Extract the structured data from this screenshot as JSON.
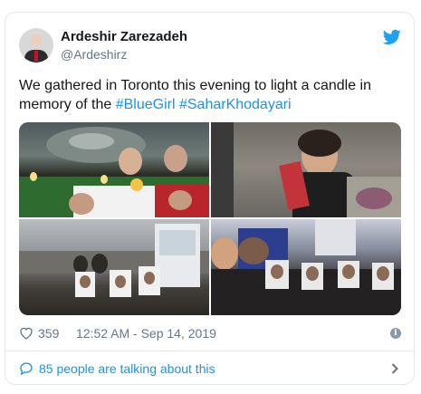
{
  "author": {
    "name": "Ardeshir Zarezadeh",
    "handle": "@Ardeshirz"
  },
  "tweet": {
    "text": "We gathered in Toronto this evening to light a candle in memory of the ",
    "hashtags": [
      "#BlueGirl",
      "#SaharKhodayari"
    ]
  },
  "media": {
    "photos": [
      {
        "name": "candle-vigil-fountain"
      },
      {
        "name": "woman-holding-sign"
      },
      {
        "name": "vigil-line-portraits"
      },
      {
        "name": "group-with-portraits-street"
      }
    ]
  },
  "meta": {
    "likes": "359",
    "timestamp": "12:52 AM - Sep 14, 2019",
    "info_label": "i"
  },
  "footer": {
    "talking": "85 people are talking about this"
  },
  "colors": {
    "link": "#1b95e0",
    "secondary": "#657786",
    "border": "#e1e8ed"
  },
  "icons": [
    "twitter-bird-icon",
    "heart-icon",
    "info-icon",
    "speech-bubble-icon",
    "chevron-right-icon"
  ]
}
